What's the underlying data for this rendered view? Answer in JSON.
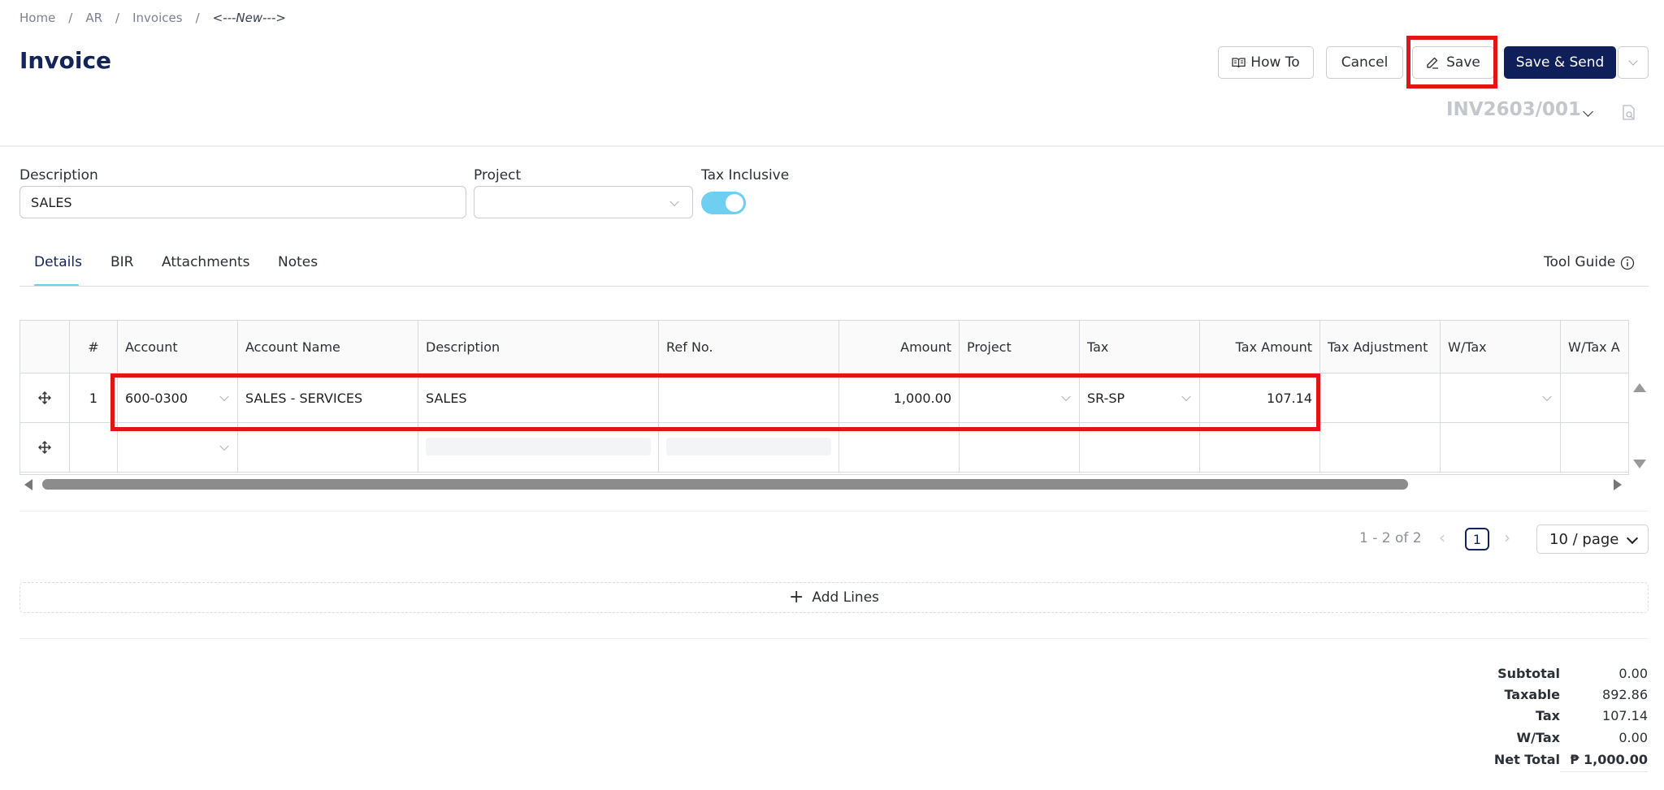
{
  "breadcrumb": [
    "Home",
    "AR",
    "Invoices",
    "<---New--->"
  ],
  "page_title": "Invoice",
  "toolbar": {
    "how_to_label": "How To",
    "cancel_label": "Cancel",
    "save_label": "Save",
    "save_send_label": "Save & Send"
  },
  "invoice_number": "INV2603/001",
  "form": {
    "description_label": "Description",
    "description_value": "SALES",
    "project_label": "Project",
    "project_value": "",
    "tax_inclusive_label": "Tax Inclusive",
    "tax_inclusive": true
  },
  "tabs": [
    "Details",
    "BIR",
    "Attachments",
    "Notes"
  ],
  "active_tab": "Details",
  "tool_guide_label": "Tool Guide",
  "grid": {
    "columns": [
      "",
      "#",
      "Account",
      "Account Name",
      "Description",
      "Ref No.",
      "Amount",
      "Project",
      "Tax",
      "Tax Amount",
      "Tax Adjustment",
      "W/Tax",
      "W/Tax A"
    ],
    "rows": [
      {
        "num": "1",
        "account": "600-0300",
        "account_name": "SALES - SERVICES",
        "description": "SALES",
        "ref_no": "",
        "amount": "1,000.00",
        "project": "",
        "tax": "SR-SP",
        "tax_amount": "107.14",
        "tax_adjustment": "",
        "wtax": ""
      },
      {
        "num": "",
        "account": "",
        "account_name": "",
        "description": "",
        "ref_no": "",
        "amount": "",
        "project": "",
        "tax": "",
        "tax_amount": "",
        "tax_adjustment": "",
        "wtax": ""
      }
    ]
  },
  "pagination": {
    "range_text": "1 - 2 of 2",
    "current_page": "1",
    "page_size": "10 / page"
  },
  "add_lines_label": "Add Lines",
  "totals": [
    {
      "label": "Subtotal",
      "value": "0.00"
    },
    {
      "label": "Taxable",
      "value": "892.86"
    },
    {
      "label": "Tax",
      "value": "107.14"
    },
    {
      "label": "W/Tax",
      "value": "0.00"
    },
    {
      "label": "Net Total",
      "value": "₱ 1,000.00"
    }
  ],
  "colors": {
    "primary": "#0e1f5a",
    "accent": "#6ecff0",
    "highlight": "#e01616"
  }
}
